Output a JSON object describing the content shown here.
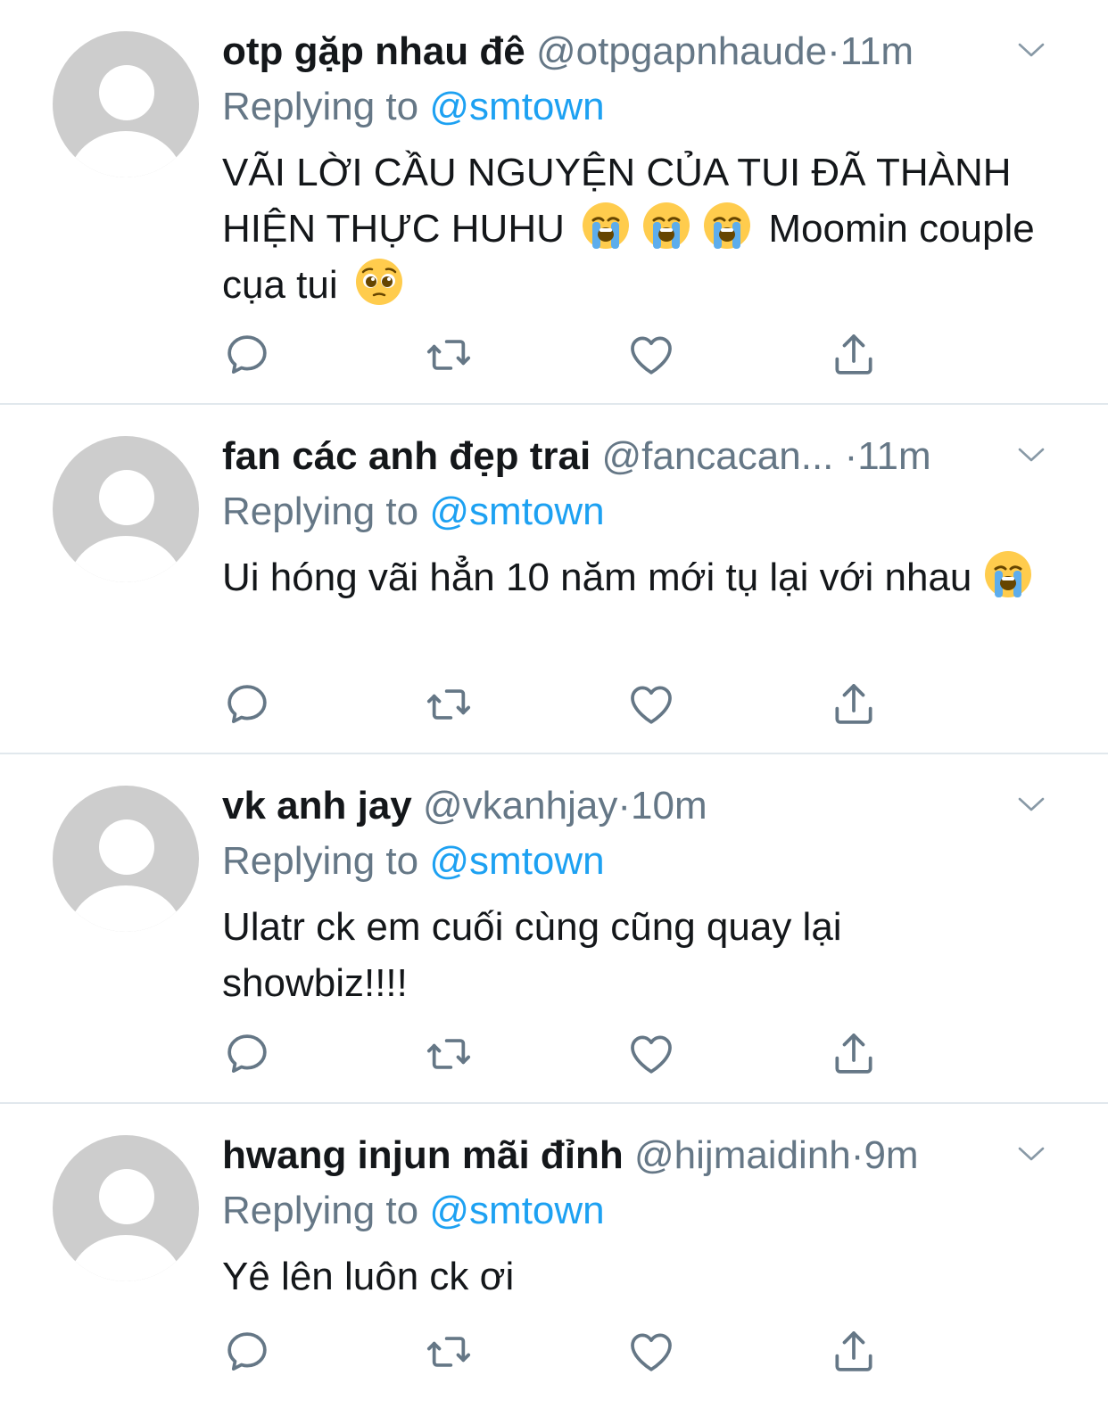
{
  "tweets": [
    {
      "name": "otp gặp nhau đê",
      "handle": "@otpgapnhaude",
      "time": "11m",
      "replying_prefix": "Replying to",
      "replying_to": "@smtown",
      "text_before": "VÃI LỜI CẦU NGUYỆN CỦA TUI ĐÃ THÀNH HIỆN THỰC HUHU",
      "text_mid": "Moomin couple cụa tui",
      "emojis": [
        "loudly-crying-face",
        "loudly-crying-face",
        "loudly-crying-face",
        "pleading-face"
      ]
    },
    {
      "name": "fan các anh đẹp trai",
      "handle": "@fancacan...",
      "time": "11m",
      "replying_prefix": "Replying to",
      "replying_to": "@smtown",
      "text_before": "Ui hóng vãi hẳn 10 năm mới tụ lại với nhau",
      "emojis": [
        "loudly-crying-face"
      ]
    },
    {
      "name": "vk anh jay",
      "handle": "@vkanhjay",
      "time": "10m",
      "replying_prefix": "Replying to",
      "replying_to": "@smtown",
      "text_before": "Ulatr ck em cuối cùng cũng quay lại showbiz!!!!"
    },
    {
      "name": "hwang injun mãi đỉnh",
      "handle": "@hijmaidinh",
      "time": "9m",
      "replying_prefix": "Replying to",
      "replying_to": "@smtown",
      "text_before": "Yê lên luôn ck ơi"
    }
  ],
  "separator": "·",
  "icons": {
    "reply": "reply-icon",
    "retweet": "retweet-icon",
    "like": "heart-icon",
    "share": "share-icon",
    "caret": "chevron-down-icon"
  },
  "colors": {
    "name": "#14171a",
    "secondary": "#657786",
    "link": "#1da1f2",
    "divider": "#e1e8ed",
    "avatar": "#cdcdcd"
  }
}
